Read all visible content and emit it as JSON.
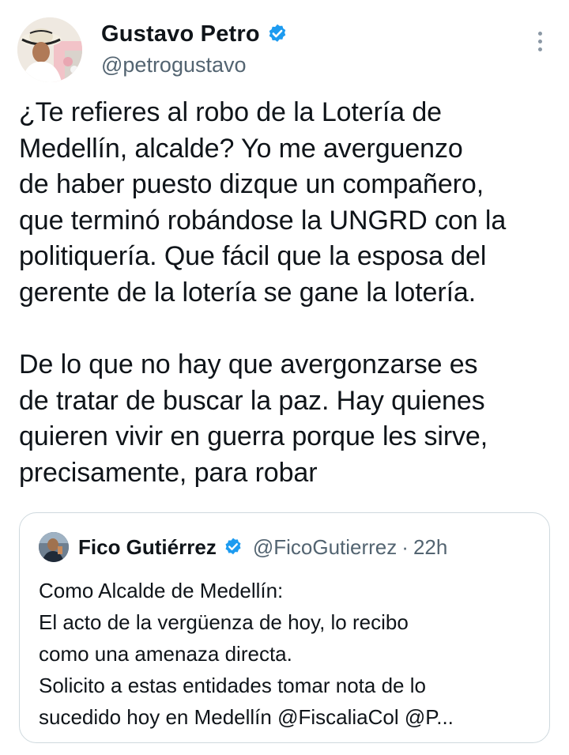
{
  "author": {
    "display_name": "Gustavo Petro",
    "handle": "@petrogustavo",
    "verified": true
  },
  "tweet_text": {
    "lines": [
      "¿Te refieres al robo de la Lotería de",
      "Medellín, alcalde? Yo me averguenzo",
      "de haber puesto dizque un compañero,",
      "que terminó robándose la UNGRD con la",
      "politiquería. Que fácil que la esposa del",
      "gerente de la lotería se gane la lotería.",
      "",
      "De lo que no hay que avergonzarse es",
      "de tratar de buscar la paz. Hay quienes",
      "quieren vivir en guerra porque les sirve,",
      "precisamente, para robar"
    ]
  },
  "quoted_tweet": {
    "display_name": "Fico Gutiérrez",
    "handle": "@FicoGutierrez",
    "separator": "·",
    "time": "22h",
    "verified": true,
    "lines": [
      "Como Alcalde de Medellín:",
      "El acto de la vergüenza de hoy,  lo recibo",
      "como una amenaza directa.",
      "Solicito a estas entidades  tomar nota de lo",
      "sucedido hoy en Medellín @FiscaliaCol @P..."
    ]
  },
  "colors": {
    "verified_badge": "#1d9bf0",
    "secondary_text": "#536471",
    "border": "#cfd9de"
  },
  "icons": {
    "more": "more-vertical-icon",
    "verified": "verified-badge-icon"
  }
}
